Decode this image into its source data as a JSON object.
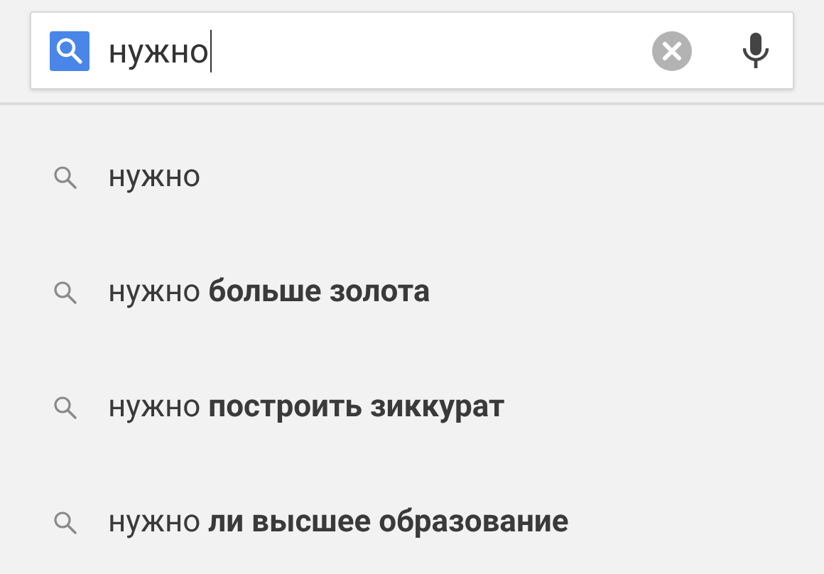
{
  "search": {
    "value": "нужно"
  },
  "suggestions": [
    {
      "text": "нужно"
    },
    {
      "text": "нужно **больше золота**"
    },
    {
      "text": "нужно **построить зиккурат**"
    },
    {
      "text": "нужно **ли высшее образование**"
    }
  ]
}
